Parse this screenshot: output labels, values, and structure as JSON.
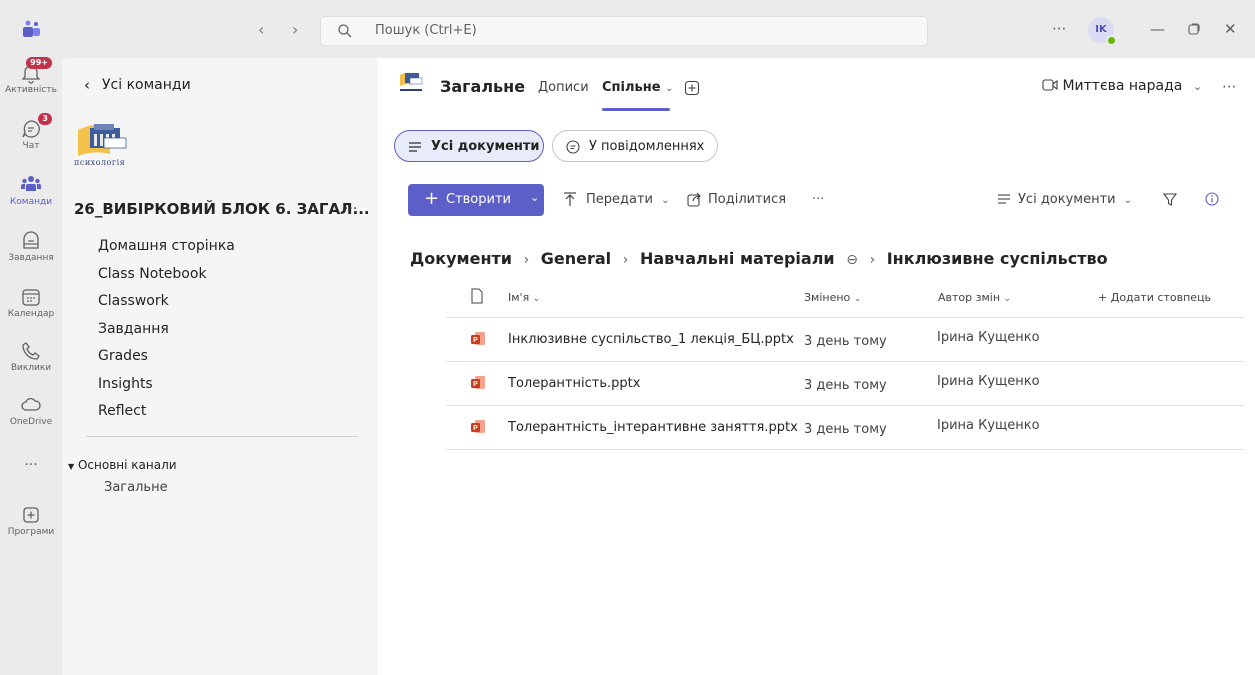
{
  "titlebar": {
    "search_placeholder": "Пошук (Ctrl+E)",
    "more": "···",
    "avatar_initials": "IK",
    "minimize": "—",
    "close": "✕"
  },
  "rail": {
    "items": [
      {
        "label": "Активність",
        "icon": "bell-icon",
        "badge": "99+"
      },
      {
        "label": "Чат",
        "icon": "chat-icon",
        "badge": "3"
      },
      {
        "label": "Команди",
        "icon": "teams-icon"
      },
      {
        "label": "Завдання",
        "icon": "assignments-icon"
      },
      {
        "label": "Календар",
        "icon": "calendar-icon"
      },
      {
        "label": "Виклики",
        "icon": "phone-icon"
      },
      {
        "label": "OneDrive",
        "icon": "cloud-icon"
      },
      {
        "label": "···",
        "icon": "more-icon"
      },
      {
        "label": "Програми",
        "icon": "add-apps-icon"
      }
    ]
  },
  "panel": {
    "back_label": "Усі команди",
    "logo_text": "психологія",
    "team_name": "26_ВИБІРКОВИЙ БЛОК 6. ЗАГАЛ...",
    "more": "···",
    "nav": [
      "Домашня сторінка",
      "Class Notebook",
      "Classwork",
      "Завдання",
      "Grades",
      "Insights",
      "Reflect"
    ],
    "channels_header": "Основні канали",
    "channel": "Загальне"
  },
  "main": {
    "channel_title": "Загальне",
    "tabs": [
      "Дописи",
      "Спільне"
    ],
    "meet_label": "Миттєва нарада",
    "more": "···",
    "pills": [
      "Усі документи",
      "У повідомленнях"
    ],
    "create_label": "Створити",
    "upload_label": "Передати",
    "share_label": "Поділитися",
    "toolbar_more": "···",
    "view_label": "Усі документи",
    "breadcrumb": [
      "Документи",
      "General",
      "Навчальні матеріали",
      "Інклюзивне суспільство"
    ],
    "columns": {
      "name": "Ім'я",
      "modified": "Змінено",
      "author": "Автор змін",
      "add_column": "Додати стовпець"
    },
    "files": [
      {
        "name": "Інклюзивне суспільство_1 лекція_БЦ.pptx",
        "modified": "3 день тому",
        "author": "Ірина Кущенко"
      },
      {
        "name": "Толерантність.pptx",
        "modified": "3 день тому",
        "author": "Ірина Кущенко"
      },
      {
        "name": "Толерантність_інтерантивне заняття.pptx",
        "modified": "3 день тому",
        "author": "Ірина Кущенко"
      }
    ]
  },
  "colors": {
    "accent": "#5b5fc7",
    "badge": "#c4314b",
    "presence": "#6bb700",
    "ppt": "#c43e1c"
  }
}
